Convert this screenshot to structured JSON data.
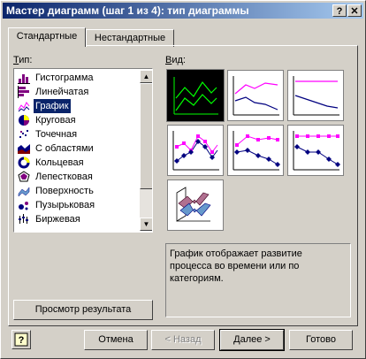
{
  "window": {
    "title": "Мастер диаграмм (шаг 1 из 4): тип диаграммы",
    "help_glyph": "?",
    "close_glyph": "✕"
  },
  "tabs": [
    {
      "label": "Стандартные",
      "active": true
    },
    {
      "label": "Нестандартные",
      "active": false
    }
  ],
  "type_label": "Тип:",
  "view_label": "Вид:",
  "chart_types": [
    {
      "label": "Гистограмма",
      "icon": "column-chart-icon",
      "selected": false
    },
    {
      "label": "Линейчатая",
      "icon": "bar-chart-icon",
      "selected": false
    },
    {
      "label": "График",
      "icon": "line-chart-icon",
      "selected": true
    },
    {
      "label": "Круговая",
      "icon": "pie-chart-icon",
      "selected": false
    },
    {
      "label": "Точечная",
      "icon": "scatter-chart-icon",
      "selected": false
    },
    {
      "label": "С областями",
      "icon": "area-chart-icon",
      "selected": false
    },
    {
      "label": "Кольцевая",
      "icon": "doughnut-chart-icon",
      "selected": false
    },
    {
      "label": "Лепестковая",
      "icon": "radar-chart-icon",
      "selected": false
    },
    {
      "label": "Поверхность",
      "icon": "surface-chart-icon",
      "selected": false
    },
    {
      "label": "Пузырьковая",
      "icon": "bubble-chart-icon",
      "selected": false
    },
    {
      "label": "Биржевая",
      "icon": "stock-chart-icon",
      "selected": false
    }
  ],
  "subtypes": [
    {
      "name": "line",
      "selected": true
    },
    {
      "name": "stacked-line",
      "selected": false
    },
    {
      "name": "100-stacked-line",
      "selected": false
    },
    {
      "name": "line-with-markers",
      "selected": false
    },
    {
      "name": "stacked-line-with-markers",
      "selected": false
    },
    {
      "name": "100-stacked-line-with-markers",
      "selected": false
    },
    {
      "name": "3d-line",
      "selected": false
    }
  ],
  "description": "График отображает развитие процесса во времени или по категориям.",
  "preview_button": "Просмотр результата",
  "buttons": {
    "cancel": "Отмена",
    "back": "< Назад",
    "next": "Далее >",
    "finish": "Готово"
  },
  "colors": {
    "title_from": "#0a246a",
    "title_to": "#a6caf0",
    "series_magenta": "#ff00ff",
    "series_navy": "#000080",
    "selected_green": "#00ff00"
  }
}
